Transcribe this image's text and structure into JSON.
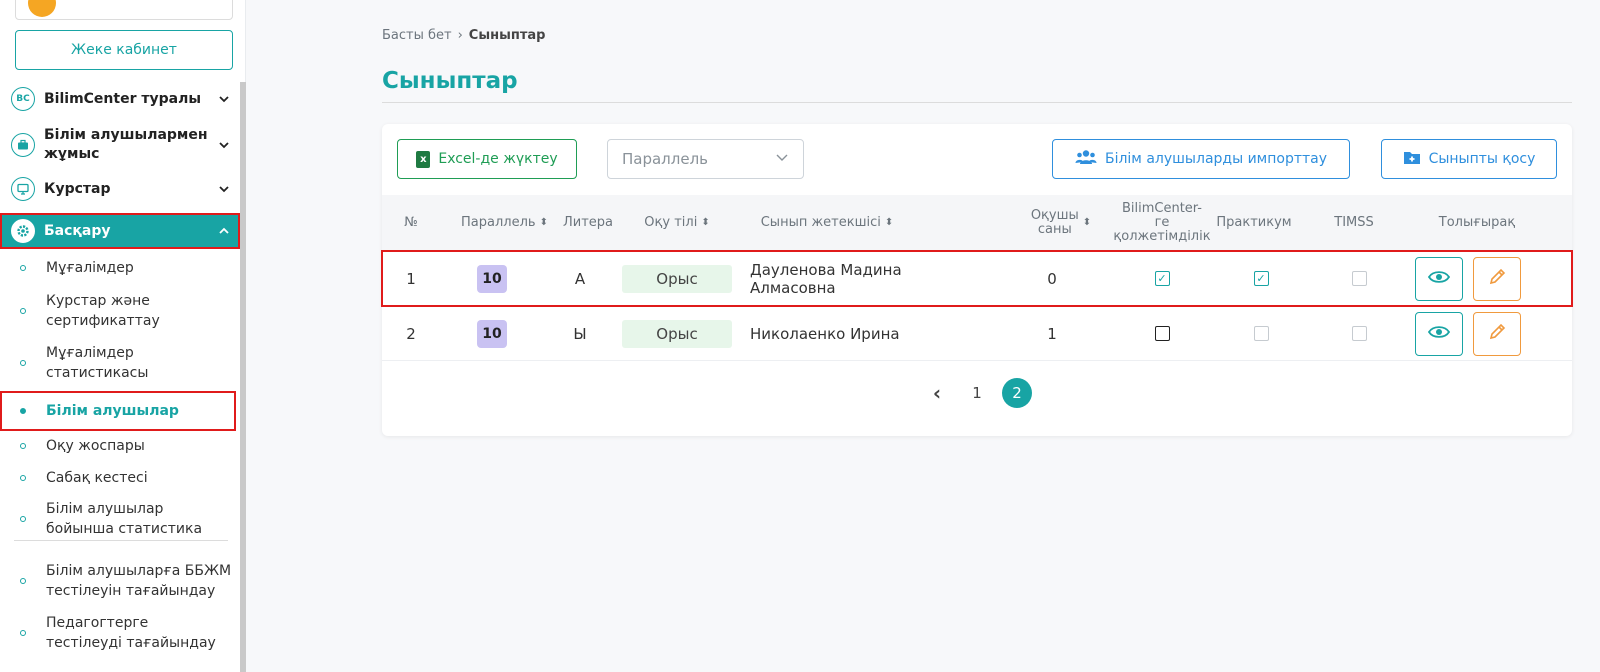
{
  "sidebar": {
    "cabinet_button": "Жеке кабинет",
    "menu": [
      {
        "label": "BilimCenter туралы",
        "icon": "bc-logo-icon",
        "icon_text": "BC"
      },
      {
        "label": "Білім алушылармен жұмыс",
        "icon": "briefcase-icon"
      },
      {
        "label": "Курстар",
        "icon": "presentation-icon"
      },
      {
        "label": "Басқару",
        "icon": "gear-icon"
      }
    ],
    "submenu": [
      "Мұғалімдер",
      "Курстар және сертификаттау",
      "Мұғалімдер статистикасы",
      "Білім алушылар",
      "Оқу жоспары",
      "Сабақ кестесі",
      "Білім алушылар бойынша статистика",
      "Білім алушыларға ББЖМ тестілеуін тағайындау",
      "Педагогтерге тестілеуді тағайындау"
    ]
  },
  "breadcrumb": {
    "home": "Басты бет",
    "separator": "›",
    "current": "Сыныптар"
  },
  "page_title": "Сыныптар",
  "toolbar": {
    "excel_button": "Excel-де жүктеу",
    "excel_icon_text": "x",
    "parallel_placeholder": "Параллель",
    "import_button": "Білім алушыларды импорттау",
    "add_button": "Сыныпты қосу"
  },
  "table": {
    "headers": {
      "num": "№",
      "parallel": "Параллель",
      "letter": "Литера",
      "language": "Оқу тілі",
      "teacher": "Сынып жетекшісі",
      "students_line1": "Оқушы",
      "students_line2": "саны",
      "access_line1": "BilimCenter-",
      "access_line2": "ге",
      "access_line3": "қолжетімділік",
      "practicum": "Практикум",
      "timss": "TIMSS",
      "more": "Толығырақ"
    },
    "rows": [
      {
        "num": "1",
        "parallel": "10",
        "letter": "А",
        "language": "Орыс",
        "teacher": "Дауленова Мадина Алмасовна",
        "students": "0",
        "access": true,
        "practicum": true,
        "timss": false
      },
      {
        "num": "2",
        "parallel": "10",
        "letter": "Ы",
        "language": "Орыс",
        "teacher": "Николаенко Ирина",
        "students": "1",
        "access": false,
        "practicum": false,
        "timss": false
      }
    ]
  },
  "pagination": {
    "prev": "‹",
    "pages": [
      "1",
      "2"
    ],
    "current": "2"
  },
  "colors": {
    "accent": "#18a4a4",
    "highlight": "#e01b1b",
    "excel": "#1f9d55",
    "blue": "#2f8fdd",
    "edit": "#f09a3e",
    "badge": "#c9c2f2"
  }
}
